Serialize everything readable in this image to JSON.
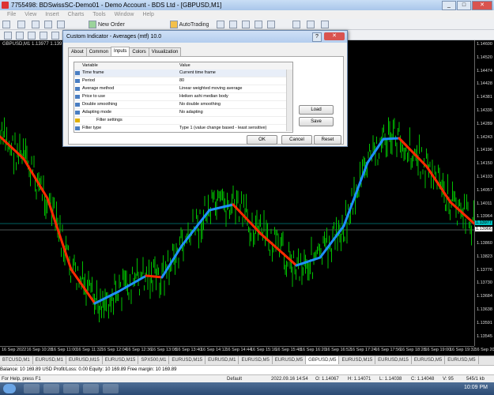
{
  "window": {
    "title": "7755498: BDSwissSC-Demo01 - Demo Account - BDS Ltd - [GBPUSD,M1]"
  },
  "menu": [
    "File",
    "View",
    "Insert",
    "Charts",
    "Tools",
    "Window",
    "Help"
  ],
  "toolbar": {
    "new_order": "New Order",
    "autotrading": "AutoTrading"
  },
  "chart": {
    "symbol_info": "GBPUSD,M1  1.13977 1.13977 1.13",
    "price_ticks": [
      "1.14600",
      "1.14520",
      "1.14474",
      "1.14428",
      "1.14381",
      "1.14335",
      "1.14289",
      "1.14243",
      "1.14196",
      "1.14150",
      "1.14103",
      "1.14057",
      "1.14011",
      "1.13964",
      "1.13918",
      "1.13860",
      "1.13823",
      "1.13776",
      "1.13730",
      "1.13684",
      "1.13638",
      "1.13591",
      "1.13545"
    ],
    "bid_label": "1.13977",
    "ask_label": "1.13966",
    "time_ticks": [
      "16 Sep 2022",
      "16 Sep 10:28",
      "16 Sep 11:00",
      "16 Sep 11:32",
      "16 Sep 12:04",
      "16 Sep 12:36",
      "16 Sep 13:08",
      "16 Sep 13:40",
      "16 Sep 14:12",
      "16 Sep 14:44",
      "16 Sep 15:16",
      "16 Sep 15:48",
      "16 Sep 16:20",
      "16 Sep 16:52",
      "16 Sep 17:24",
      "16 Sep 17:56",
      "16 Sep 18:28",
      "16 Sep 19:00",
      "16 Sep 19:32",
      "16 Sep 20:04"
    ],
    "colors": {
      "up": "#1e90ff",
      "down": "#ff2a00",
      "candles": "#00c000",
      "bid_line": "#00c0c0"
    }
  },
  "dialog": {
    "title": "Custom Indicator - Averages (mtf) 10.0",
    "tabs": [
      "About",
      "Common",
      "Inputs",
      "Colors",
      "Visualization"
    ],
    "active_tab": "Inputs",
    "columns": [
      "Variable",
      "Value"
    ],
    "rows": [
      {
        "variable": "Time frame",
        "value": "Current time frame"
      },
      {
        "variable": "Period",
        "value": "80"
      },
      {
        "variable": "Average method",
        "value": "Linear weighted moving average"
      },
      {
        "variable": "Price to use",
        "value": "Heiken ashi median body"
      },
      {
        "variable": "Double smoothing",
        "value": "No double smoothing"
      },
      {
        "variable": "Adapting mode",
        "value": "No adapting"
      },
      {
        "variable": "Filter settings",
        "value": ""
      },
      {
        "variable": "Filter type",
        "value": "Type 1 (value change based - least sensitive)"
      }
    ],
    "buttons": {
      "load": "Load",
      "save": "Save",
      "ok": "OK",
      "cancel": "Cancel",
      "reset": "Reset"
    }
  },
  "tabs": [
    "BTCUSD,M1",
    "EURUSD,M1",
    "EURUSD,M15",
    "EURUSD,M15",
    "SPX500,M1",
    "EURUSD,M15",
    "EURUSD,M1",
    "EURUSD,M5",
    "EURUSD,M5",
    "GBPUSD,M5",
    "EURUSD,M15",
    "EURUSD,M15",
    "EURUSD,M5",
    "EURUSD,M5",
    "EU +"
  ],
  "terminal": "Balance: 10 169.89 USD  Profit/Loss: 0.00  Equity: 10 169.89  Free margin: 10 169.89",
  "status": {
    "help": "For Help, press F1",
    "profile": "Default",
    "datetime": "2022.09.16 14:54",
    "open": "O: 1.14067",
    "high": "H: 1.14071",
    "low": "L: 1.14038",
    "close": "C: 1.14048",
    "volume": "V: 95",
    "traffic": "545/1 kb"
  },
  "clock": "10:09 PM"
}
